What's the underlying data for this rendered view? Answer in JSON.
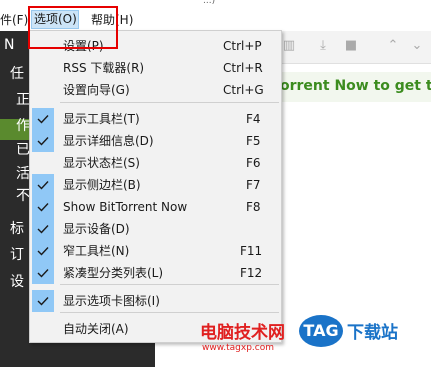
{
  "window": {
    "title_fragment": "...)"
  },
  "menubar": {
    "file_label": "件(F)",
    "options_label": "选项(O)",
    "help_label": "帮助(H)"
  },
  "sidebar": {
    "items": [
      "N",
      "任",
      "正",
      "作",
      "已",
      "活",
      "不",
      "标",
      "订",
      "设"
    ]
  },
  "banner": {
    "text": "orrent Now to get to"
  },
  "options_menu": {
    "items": [
      {
        "label": "设置(P)",
        "shortcut": "Ctrl+P",
        "checked": false
      },
      {
        "label": "RSS 下载器(R)",
        "shortcut": "Ctrl+R",
        "checked": false
      },
      {
        "label": "设置向导(G)",
        "shortcut": "Ctrl+G",
        "checked": false
      },
      {
        "label": "显示工具栏(T)",
        "shortcut": "F4",
        "checked": true
      },
      {
        "label": "显示详细信息(D)",
        "shortcut": "F5",
        "checked": true
      },
      {
        "label": "显示状态栏(S)",
        "shortcut": "F6",
        "checked": false
      },
      {
        "label": "显示侧边栏(B)",
        "shortcut": "F7",
        "checked": true
      },
      {
        "label": "Show BitTorrent Now",
        "shortcut": "F8",
        "checked": true
      },
      {
        "label": "显示设备(D)",
        "shortcut": "",
        "checked": true
      },
      {
        "label": "窄工具栏(N)",
        "shortcut": "F11",
        "checked": true
      },
      {
        "label": "紧凑型分类列表(L)",
        "shortcut": "F12",
        "checked": true
      },
      {
        "label": "显示选项卡图标(I)",
        "shortcut": "",
        "checked": true
      },
      {
        "label": "自动关闭(A)",
        "shortcut": "",
        "checked": false
      }
    ]
  },
  "watermark": {
    "text": "电脑技术网",
    "url": "www.tagxp.com",
    "tag": "TAG",
    "tail": "下载站"
  },
  "colors": {
    "check_bg": "#90c8f6",
    "highlight_red": "#e60000",
    "sidebar_bg": "#2b2b2b",
    "accent_green": "#3c8c1f"
  }
}
